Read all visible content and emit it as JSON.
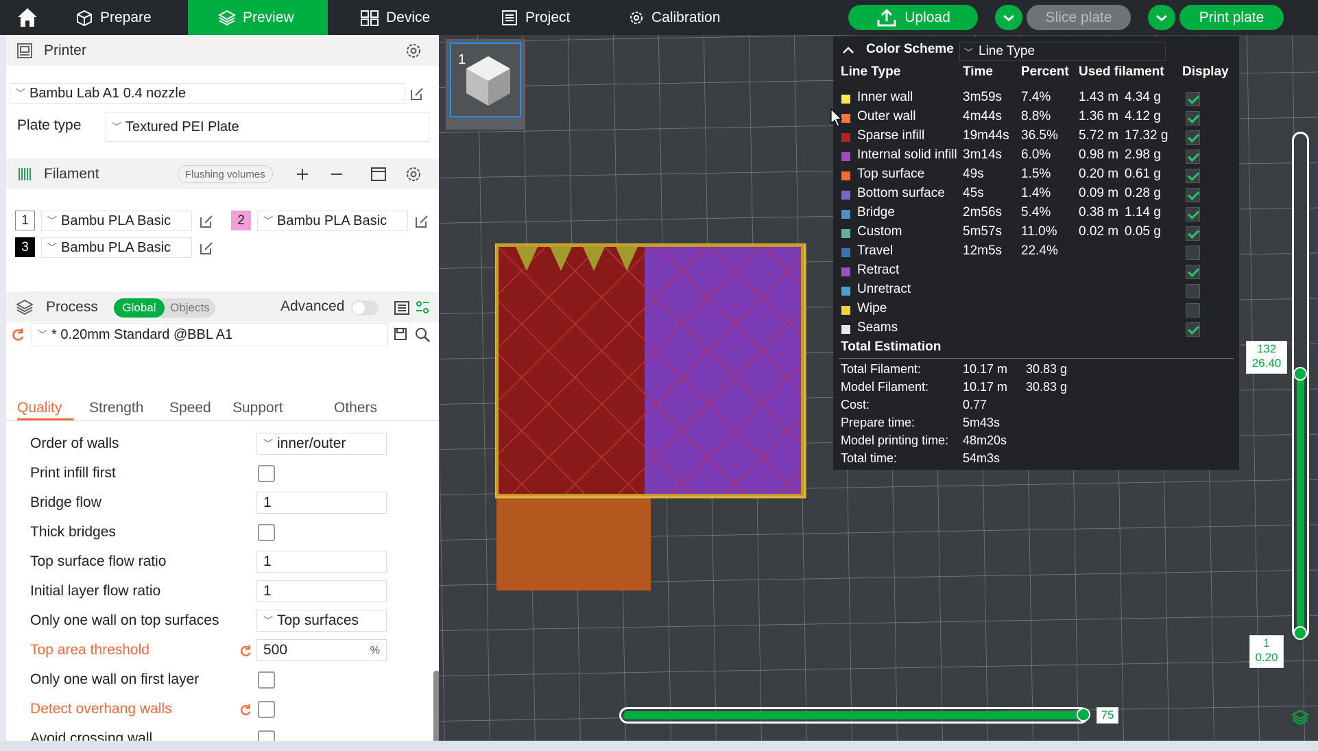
{
  "topbar": {
    "tabs": [
      {
        "label": "Prepare"
      },
      {
        "label": "Preview"
      },
      {
        "label": "Device"
      },
      {
        "label": "Project"
      },
      {
        "label": "Calibration"
      }
    ],
    "upload_label": "Upload",
    "slice_label": "Slice plate",
    "print_label": "Print plate"
  },
  "printer": {
    "title": "Printer",
    "selected": "Bambu Lab A1 0.4 nozzle",
    "plate_type_label": "Plate type",
    "plate_type_value": "Textured PEI Plate"
  },
  "filament": {
    "title": "Filament",
    "flushing_label": "Flushing volumes",
    "slots": [
      {
        "num": "1",
        "name": "Bambu PLA Basic",
        "color": "#ffffff",
        "text_color": "#222222"
      },
      {
        "num": "2",
        "name": "Bambu PLA Basic",
        "color": "#f29fd8",
        "text_color": "#222222"
      },
      {
        "num": "3",
        "name": "Bambu PLA Basic",
        "color": "#000000",
        "text_color": "#ffffff"
      }
    ]
  },
  "process": {
    "title": "Process",
    "global_label": "Global",
    "objects_label": "Objects",
    "advanced_label": "Advanced",
    "profile": "* 0.20mm Standard @BBL A1",
    "tabs": [
      "Quality",
      "Strength",
      "Speed",
      "Support",
      "Others"
    ],
    "settings": [
      {
        "label": "Order of walls",
        "value": "inner/outer",
        "type": "combo"
      },
      {
        "label": "Print infill first",
        "type": "check"
      },
      {
        "label": "Bridge flow",
        "value": "1",
        "type": "text"
      },
      {
        "label": "Thick bridges",
        "type": "check"
      },
      {
        "label": "Top surface flow ratio",
        "value": "1",
        "type": "text"
      },
      {
        "label": "Initial layer flow ratio",
        "value": "1",
        "type": "text"
      },
      {
        "label": "Only one wall on top surfaces",
        "value": "Top surfaces",
        "type": "combo"
      },
      {
        "label": "Top area threshold",
        "value": "500",
        "unit": "%",
        "type": "text",
        "modified": true
      },
      {
        "label": "Only one wall on first layer",
        "type": "check"
      },
      {
        "label": "Detect overhang walls",
        "type": "check",
        "modified": true
      },
      {
        "label": "Avoid crossing wall",
        "type": "check"
      }
    ]
  },
  "viewport": {
    "plate_number": "1",
    "layer_top": "132",
    "height_top": "26.40",
    "layer_bottom": "1",
    "height_bottom": "0.20",
    "move_value": "75"
  },
  "legend": {
    "color_scheme_label": "Color Scheme",
    "color_scheme_value": "Line Type",
    "columns": [
      "Line Type",
      "Time",
      "Percent",
      "Used filament",
      "Display"
    ],
    "rows": [
      {
        "name": "Inner wall",
        "color": "#ffe84d",
        "time": "3m59s",
        "percent": "7.4%",
        "length": "1.43 m",
        "weight": "4.34 g",
        "display": true
      },
      {
        "name": "Outer wall",
        "color": "#ff7538",
        "time": "4m44s",
        "percent": "8.8%",
        "length": "1.36 m",
        "weight": "4.12 g",
        "display": true
      },
      {
        "name": "Sparse infill",
        "color": "#b3221f",
        "time": "19m44s",
        "percent": "36.5%",
        "length": "5.72 m",
        "weight": "17.32 g",
        "display": true
      },
      {
        "name": "Internal solid infill",
        "color": "#a347c4",
        "time": "3m14s",
        "percent": "6.0%",
        "length": "0.98 m",
        "weight": "2.98 g",
        "display": true
      },
      {
        "name": "Top surface",
        "color": "#ff6633",
        "time": "49s",
        "percent": "1.5%",
        "length": "0.20 m",
        "weight": "0.61 g",
        "display": true
      },
      {
        "name": "Bottom surface",
        "color": "#7a66c7",
        "time": "45s",
        "percent": "1.4%",
        "length": "0.09 m",
        "weight": "0.28 g",
        "display": true
      },
      {
        "name": "Bridge",
        "color": "#4b8fcc",
        "time": "2m56s",
        "percent": "5.4%",
        "length": "0.38 m",
        "weight": "1.14 g",
        "display": true
      },
      {
        "name": "Custom",
        "color": "#5eb39e",
        "time": "5m57s",
        "percent": "11.0%",
        "length": "0.02 m",
        "weight": "0.05 g",
        "display": true
      },
      {
        "name": "Travel",
        "color": "#3a73b8",
        "time": "12m5s",
        "percent": "22.4%",
        "length": "",
        "weight": "",
        "display": false
      },
      {
        "name": "Retract",
        "color": "#a24cc7",
        "time": "",
        "percent": "",
        "length": "",
        "weight": "",
        "display": true
      },
      {
        "name": "Unretract",
        "color": "#4aa0db",
        "time": "",
        "percent": "",
        "length": "",
        "weight": "",
        "display": false
      },
      {
        "name": "Wipe",
        "color": "#f0d33a",
        "time": "",
        "percent": "",
        "length": "",
        "weight": "",
        "display": false
      },
      {
        "name": "Seams",
        "color": "#e6e6e6",
        "time": "",
        "percent": "",
        "length": "",
        "weight": "",
        "display": true
      }
    ],
    "total_title": "Total Estimation",
    "totals": [
      {
        "label": "Total Filament:",
        "v1": "10.17 m",
        "v2": "30.83 g"
      },
      {
        "label": "Model Filament:",
        "v1": "10.17 m",
        "v2": "30.83 g"
      },
      {
        "label": "Cost:",
        "v1": "0.77",
        "v2": ""
      },
      {
        "label": "Prepare time:",
        "v1": "5m43s",
        "v2": ""
      },
      {
        "label": "Model printing time:",
        "v1": "48m20s",
        "v2": ""
      },
      {
        "label": "Total time:",
        "v1": "54m3s",
        "v2": ""
      }
    ]
  }
}
